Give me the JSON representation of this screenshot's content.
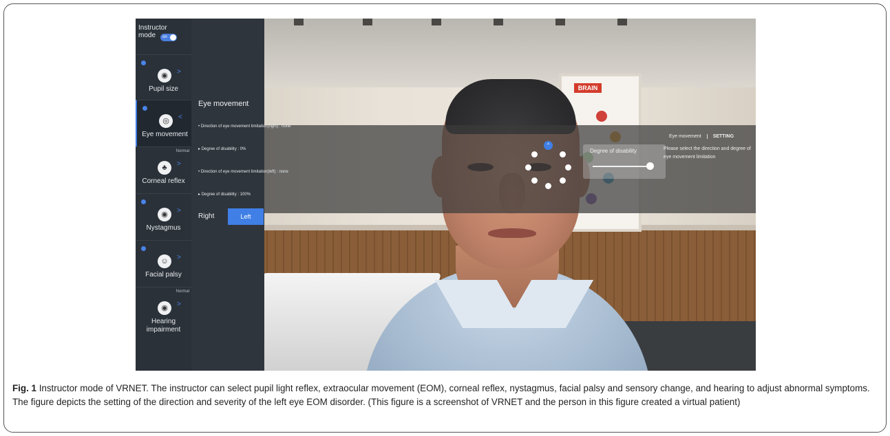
{
  "sidebar": {
    "instructor_label": "Instructor mode",
    "toggle_state": "on",
    "items": [
      {
        "label": "Pupil size",
        "icon": "eye-icon",
        "glyph": "◉",
        "badge": true,
        "status": "",
        "arrow": ">"
      },
      {
        "label": "Eye movement",
        "icon": "eye-movement-icon",
        "glyph": "◎",
        "badge": true,
        "status": "",
        "arrow": "<"
      },
      {
        "label": "Corneal reflex",
        "icon": "cotton-swab-icon",
        "glyph": "♣",
        "badge": false,
        "status": "Normal",
        "arrow": ">"
      },
      {
        "label": "Nystagmus",
        "icon": "eye-icon",
        "glyph": "◉",
        "badge": true,
        "status": "",
        "arrow": ">"
      },
      {
        "label": "Facial palsy",
        "icon": "face-icon",
        "glyph": "☺",
        "badge": true,
        "status": "",
        "arrow": ">"
      },
      {
        "label": "Hearing impairment",
        "icon": "ear-icon",
        "glyph": "◉",
        "badge": false,
        "status": "Normal",
        "arrow": ">"
      }
    ]
  },
  "panel": {
    "title": "Eye movement",
    "lines": [
      "Direction of eye movement limitation(right) : none",
      "Degree of disability : 0%",
      "Direction of eye movement limitation(left) : none",
      "Degree of disability : 100%"
    ],
    "tab_right": "Right",
    "tab_left": "Left",
    "active_tab": "Left"
  },
  "overlay": {
    "slider_label": "Degree of disability",
    "slider_value": 1.0,
    "setting_title": "Eye movement",
    "setting_tag": "SETTING",
    "setting_desc": "Please select the direction and degree of eye movement limitation",
    "selected_direction": "up",
    "selected_glyph": "^"
  },
  "caption": {
    "label": "Fig. 1",
    "text": " Instructor mode of VRNET. The instructor can select pupil light reflex, extraocular movement (EOM), corneal reflex, nystagmus, facial palsy and sensory change, and hearing to adjust abnormal symptoms. The figure depicts the setting of the direction and severity of the left eye EOM disorder. (This figure is a screenshot of VRNET and the person in this figure created a virtual patient)"
  },
  "poster": {
    "title": "BRAIN"
  }
}
